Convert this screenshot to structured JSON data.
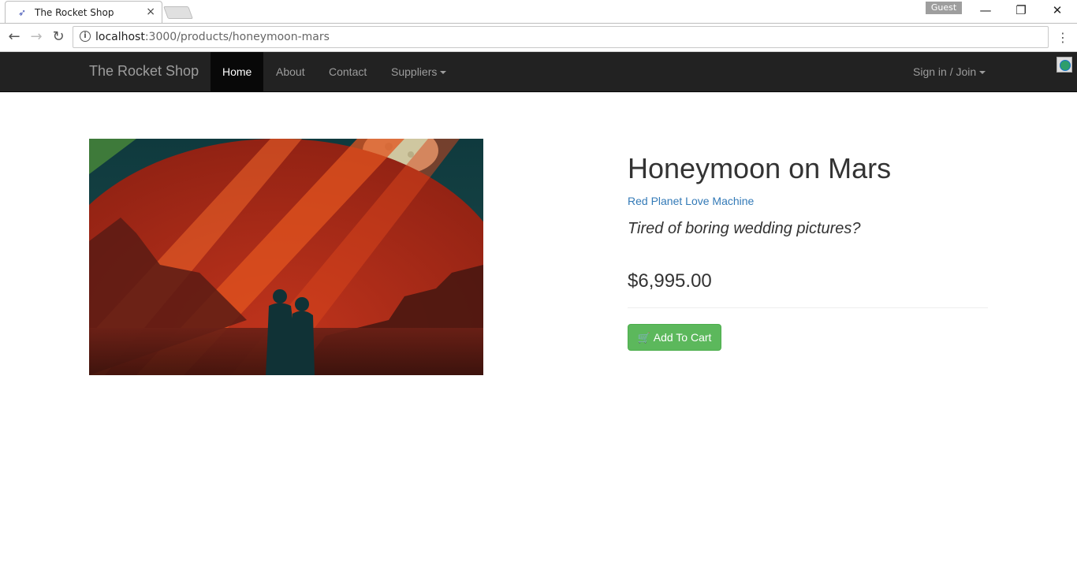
{
  "browser": {
    "tab_title": "The Rocket Shop",
    "tab_close": "×",
    "profile": "Guest",
    "url_host": "localhost",
    "url_path": ":3000/products/honeymoon-mars",
    "win_minimize": "—",
    "win_restore": "❐",
    "win_close": "✕"
  },
  "navbar": {
    "brand": "The Rocket Shop",
    "items": [
      {
        "label": "Home",
        "active": true
      },
      {
        "label": "About"
      },
      {
        "label": "Contact"
      },
      {
        "label": "Suppliers"
      }
    ],
    "signin": "Sign in / Join"
  },
  "product": {
    "title": "Honeymoon on Mars",
    "supplier": "Red Planet Love Machine",
    "tagline": "Tired of boring wedding pictures?",
    "price": "$6,995.00",
    "add_to_cart": "Add To Cart"
  },
  "colors": {
    "navbar_bg": "#222222",
    "link": "#337ab7",
    "success_button": "#5cb85c"
  }
}
